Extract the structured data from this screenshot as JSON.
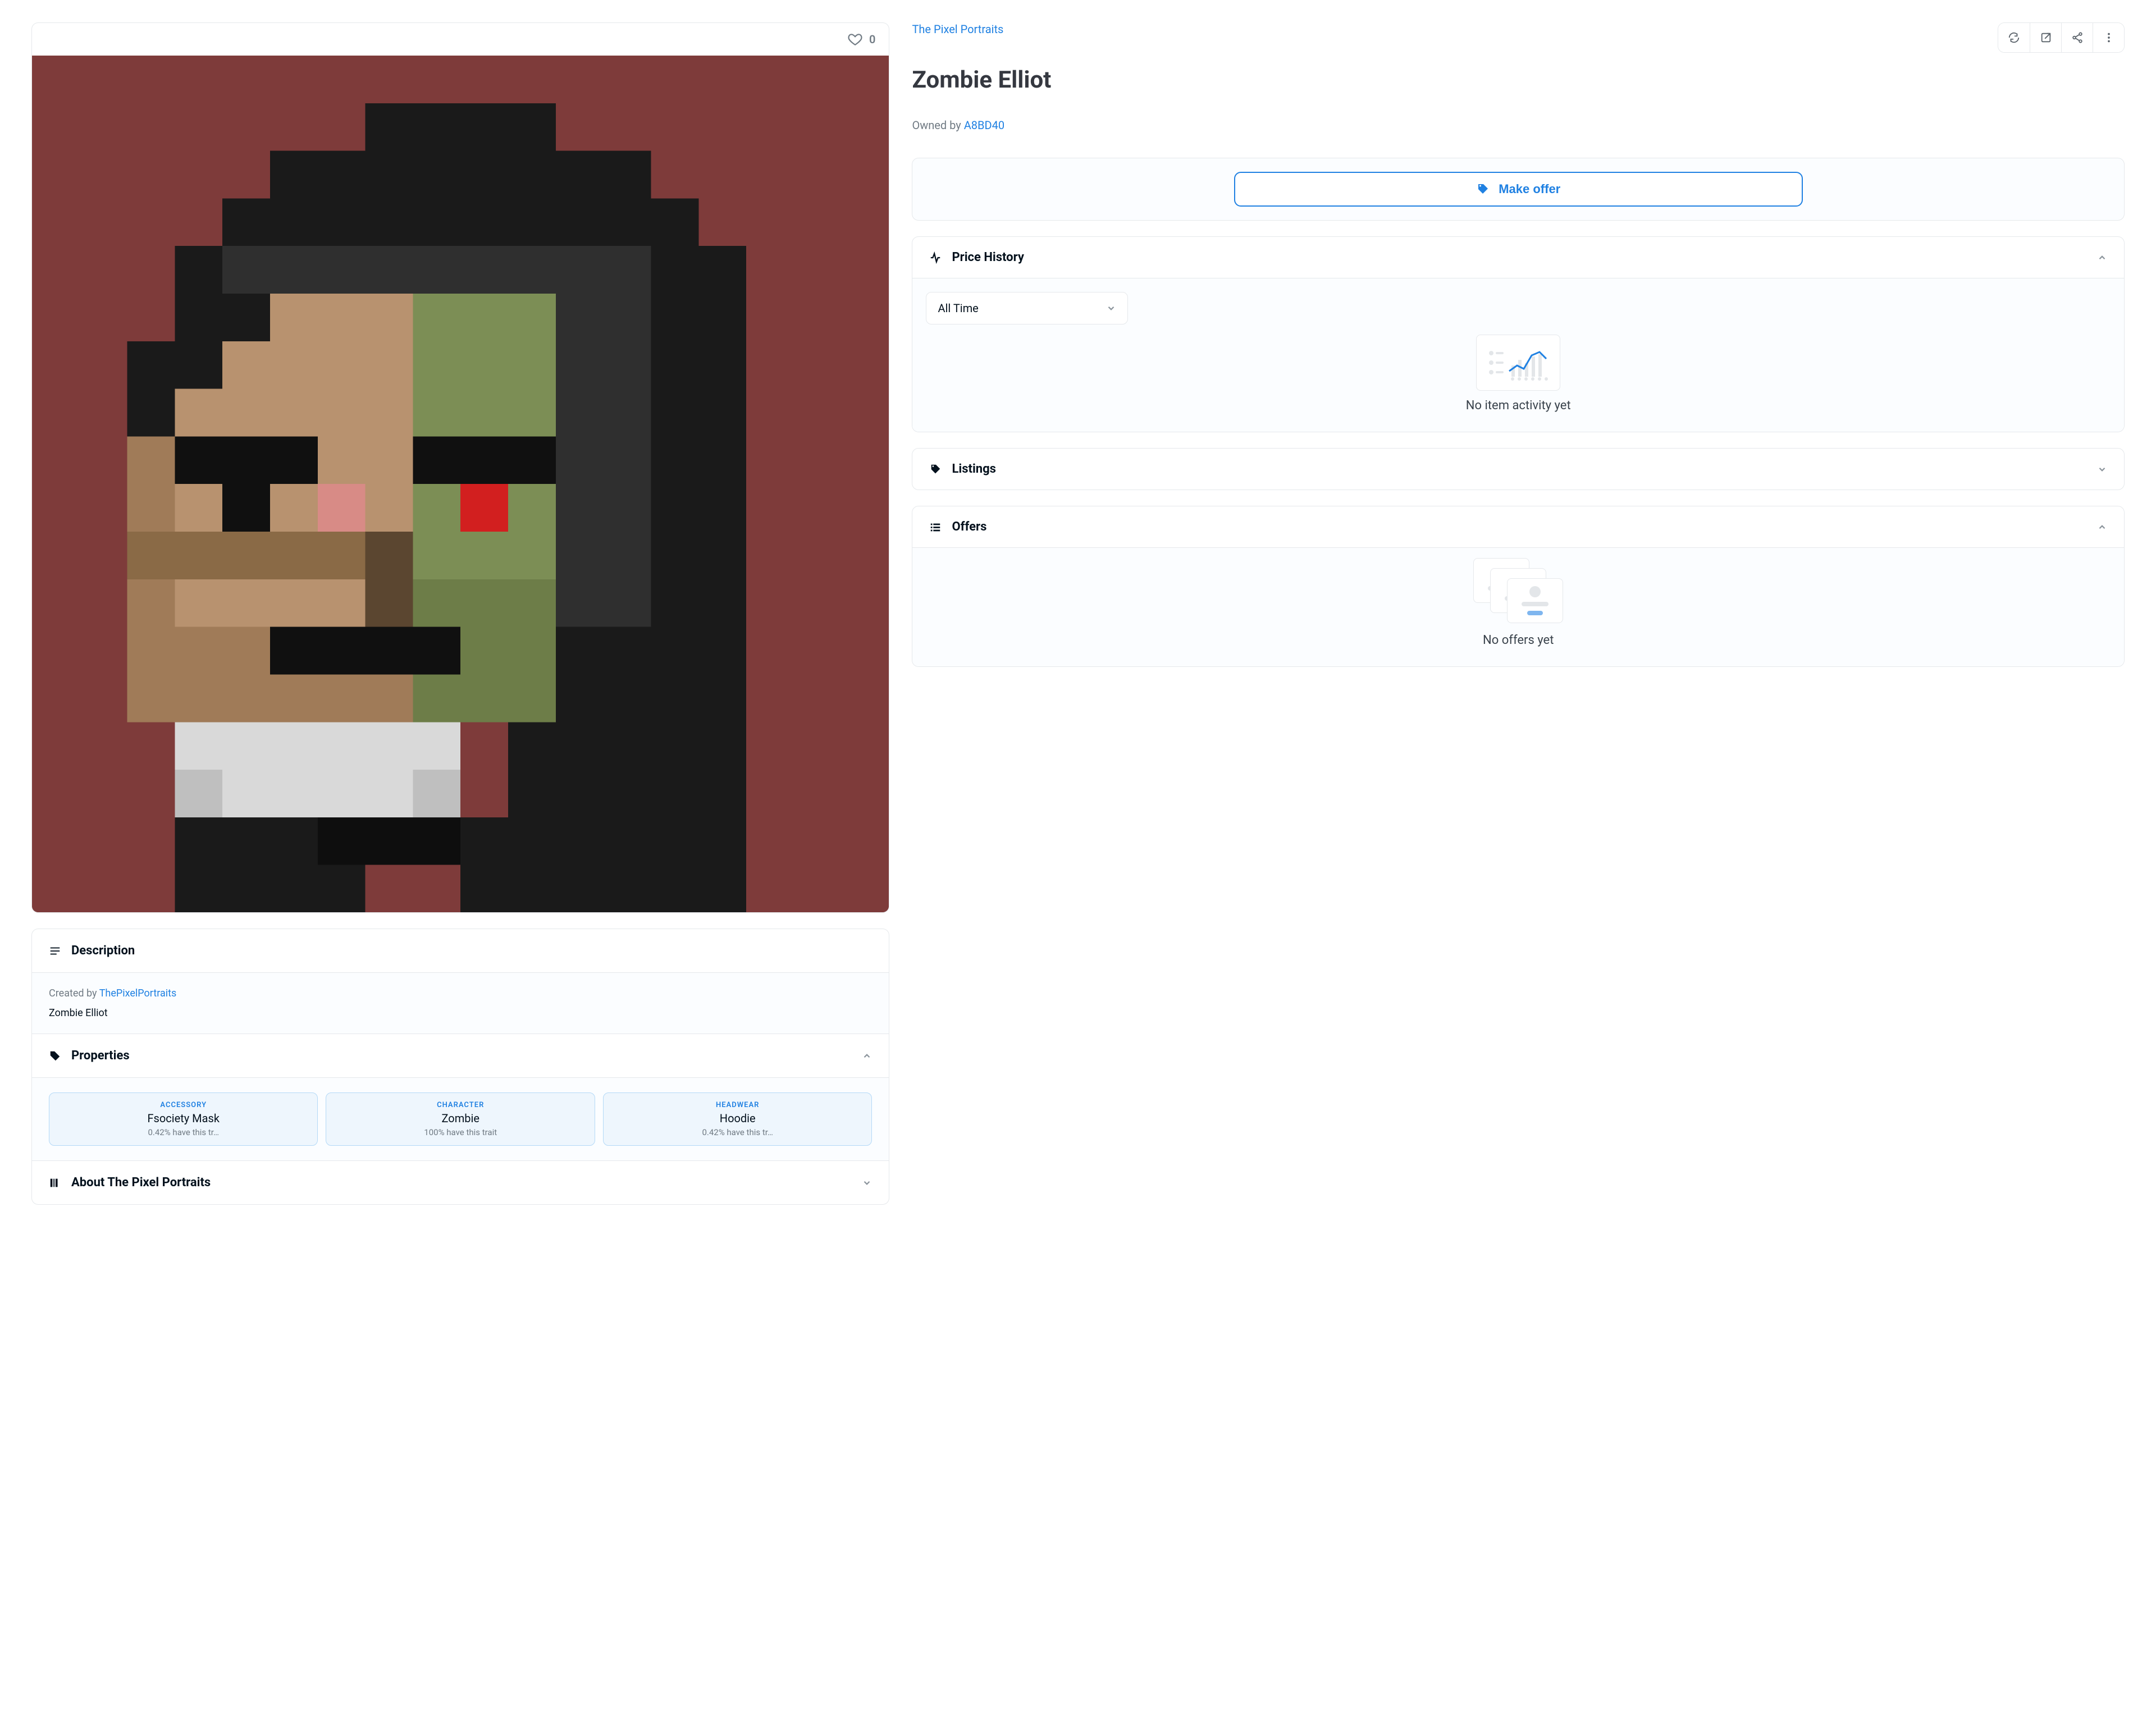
{
  "collection": {
    "name": "The Pixel Portraits"
  },
  "item": {
    "title": "Zombie Elliot",
    "favorites": "0"
  },
  "owner": {
    "label": "Owned by ",
    "name": "A8BD40"
  },
  "image": {
    "bg": "#7e3b3a"
  },
  "actions": {
    "make_offer": "Make offer"
  },
  "description": {
    "header": "Description",
    "created_prefix": "Created by ",
    "creator": "ThePixelPortraits",
    "body": "Zombie Elliot"
  },
  "properties": {
    "header": "Properties",
    "items": [
      {
        "type": "ACCESSORY",
        "value": "Fsociety Mask",
        "rarity": "0.42% have this tr…"
      },
      {
        "type": "CHARACTER",
        "value": "Zombie",
        "rarity": "100% have this trait"
      },
      {
        "type": "HEADWEAR",
        "value": "Hoodie",
        "rarity": "0.42% have this tr…"
      }
    ]
  },
  "about": {
    "header": "About The Pixel Portraits"
  },
  "price_history": {
    "header": "Price History",
    "range_label": "All Time",
    "empty": "No item activity yet"
  },
  "listings": {
    "header": "Listings"
  },
  "offers": {
    "header": "Offers",
    "empty": "No offers yet"
  }
}
